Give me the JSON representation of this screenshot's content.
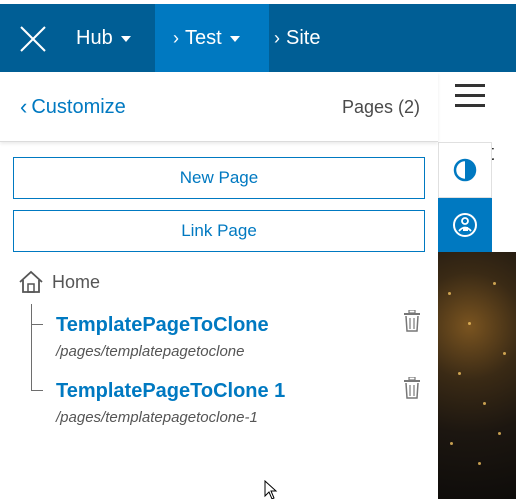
{
  "topnav": {
    "hub_label": "Hub",
    "test_label": "Test",
    "site_label": "Site"
  },
  "panel": {
    "back_label": "Customize",
    "pages_count": "Pages (2)",
    "new_page_label": "New Page",
    "link_page_label": "Link Page",
    "home_label": "Home",
    "pages": [
      {
        "title": "TemplatePageToClone",
        "path": "/pages/templatepagetoclone"
      },
      {
        "title": "TemplatePageToClone 1",
        "path": "/pages/templatepagetoclone-1"
      }
    ]
  },
  "site_preview": {
    "partial_char": "t"
  },
  "colors": {
    "nav_bg": "#005e95",
    "nav_active": "#0079c1",
    "accent": "#0079c1"
  }
}
